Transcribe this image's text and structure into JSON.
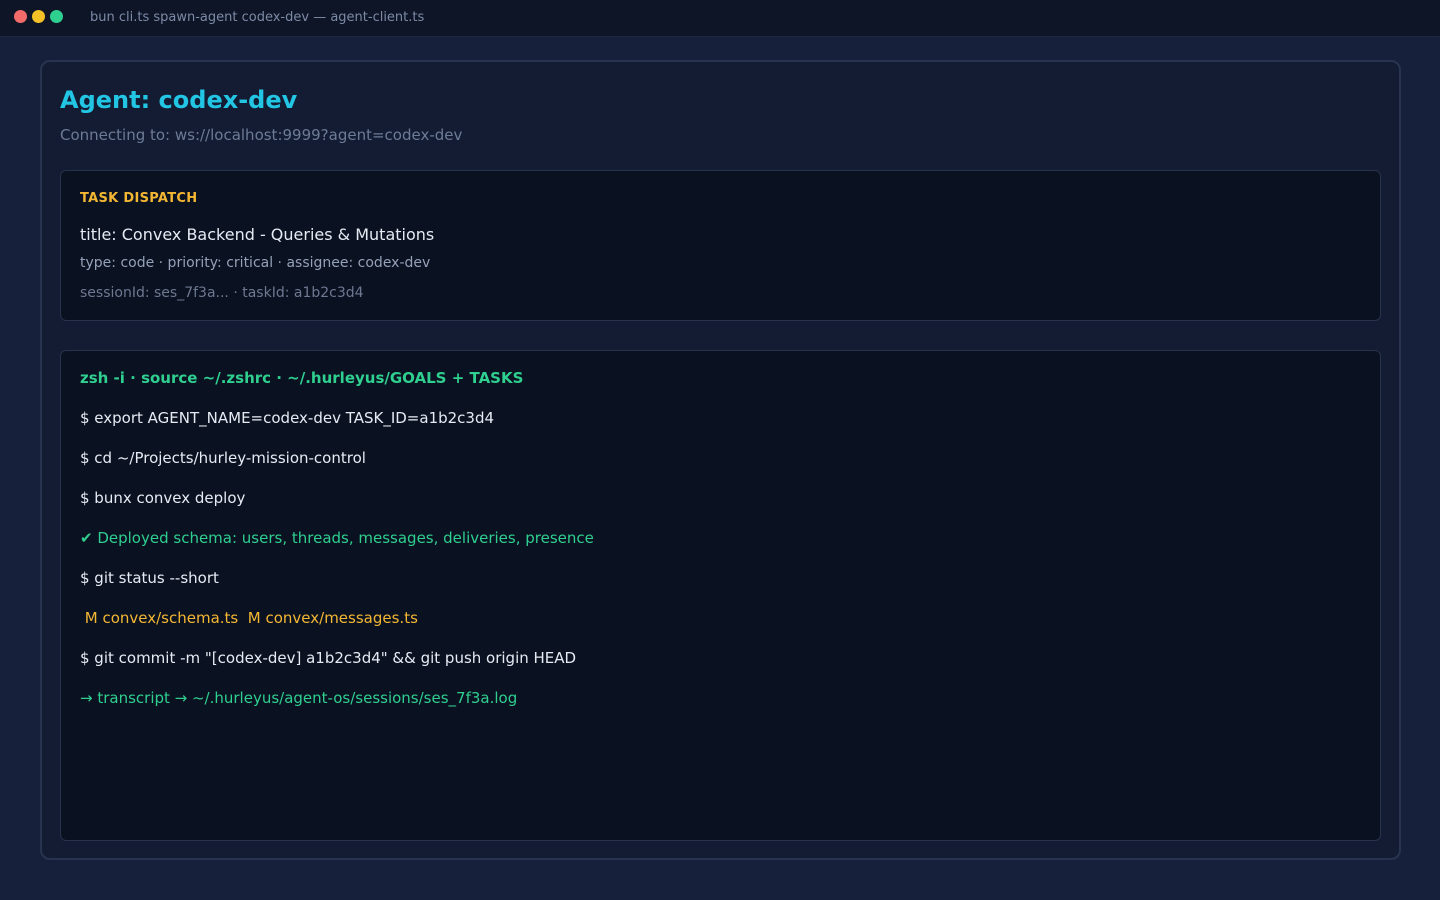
{
  "window": {
    "title": "bun cli.ts spawn-agent codex-dev — agent-client.ts"
  },
  "agent": {
    "title": "Agent: codex-dev",
    "connecting": "Connecting to: ws://localhost:9999?agent=codex-dev"
  },
  "task": {
    "label": "TASK DISPATCH",
    "title": "title: Convex Backend - Queries & Mutations",
    "meta": "type: code · priority: critical · assignee: codex-dev",
    "ids": "sessionId: ses_7f3a...  ·  taskId: a1b2c3d4"
  },
  "terminal": {
    "header": "zsh -i  ·  source ~/.zshrc  ·  ~/.hurleyus/GOALS + TASKS",
    "lines": [
      "$ export AGENT_NAME=codex-dev TASK_ID=a1b2c3d4",
      "$ cd ~/Projects/hurley-mission-control",
      "$ bunx convex deploy",
      "✔ Deployed schema: users, threads, messages, deliveries, presence",
      "$ git status --short",
      " M convex/schema.ts  M convex/messages.ts",
      "$ git commit -m \"[codex-dev] a1b2c3d4\" && git push origin HEAD",
      "→ transcript → ~/.hurleyus/agent-os/sessions/ses_7f3a.log"
    ]
  },
  "colors": {
    "accent_cyan": "#22c6e4",
    "accent_amber": "#f4b733",
    "accent_green": "#2fcf8f",
    "background": "#16203a"
  }
}
